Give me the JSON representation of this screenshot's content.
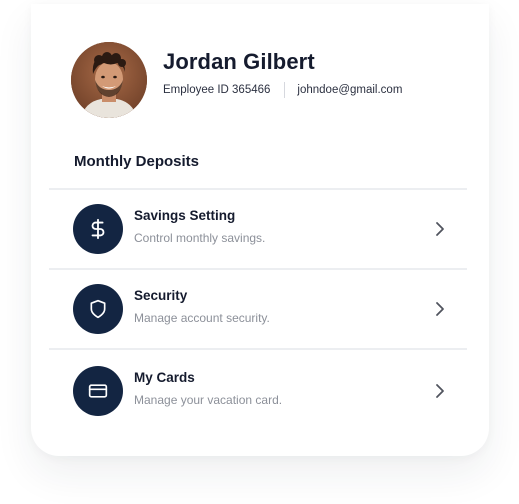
{
  "profile": {
    "name": "Jordan Gilbert",
    "employee_id": "Employee ID 365466",
    "email": "johndoe@gmail.com"
  },
  "section_title": "Monthly Deposits",
  "items": [
    {
      "title": "Savings Setting",
      "subtitle": "Control monthly savings.",
      "icon": "dollar-icon"
    },
    {
      "title": "Security",
      "subtitle": "Manage account security.",
      "icon": "shield-icon"
    },
    {
      "title": "My Cards",
      "subtitle": "Manage your vacation card.",
      "icon": "credit-card-icon"
    }
  ],
  "colors": {
    "icon_bg": "#132542",
    "title_text": "#151b2e",
    "subtitle_text": "#8c9099",
    "divider": "#eceef1"
  }
}
